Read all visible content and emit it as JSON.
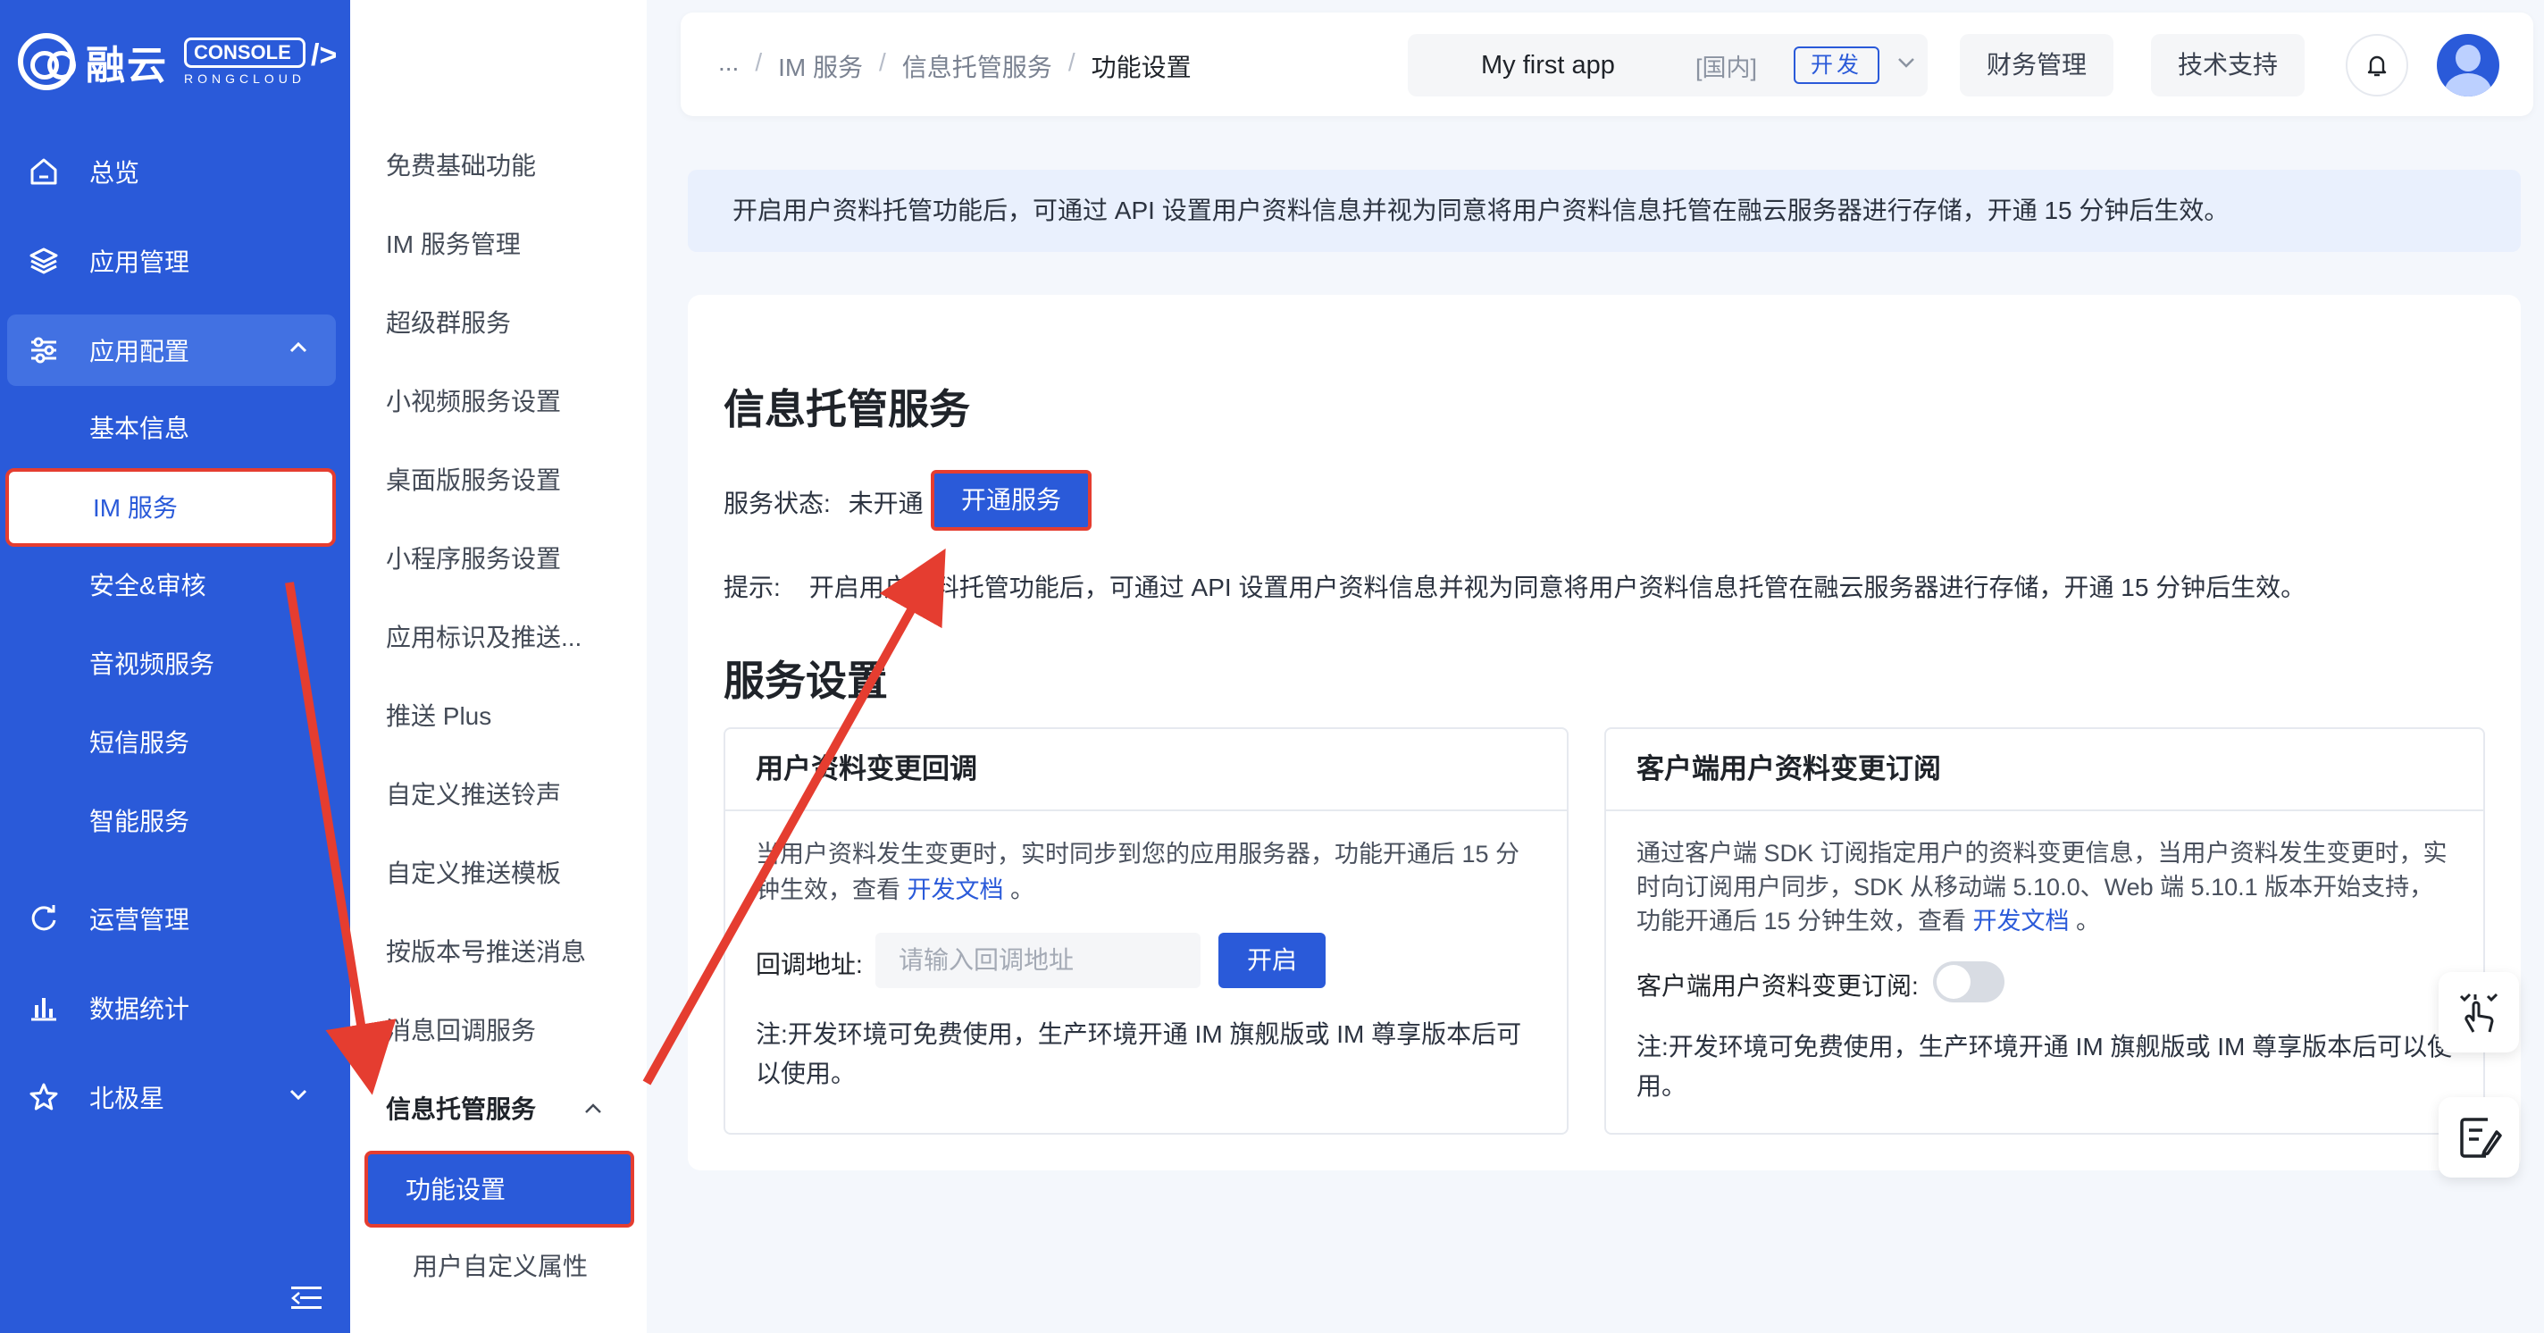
{
  "brand": {
    "name": "融云",
    "console": "CONSOLE",
    "sub": "RONGCLOUD"
  },
  "nav": {
    "items": [
      {
        "label": "总览",
        "icon": "home-icon"
      },
      {
        "label": "应用管理",
        "icon": "layers-icon"
      },
      {
        "label": "应用配置",
        "icon": "sliders-icon"
      },
      {
        "label": "运营管理",
        "icon": "refresh-icon"
      },
      {
        "label": "数据统计",
        "icon": "bar-chart-icon"
      },
      {
        "label": "北极星",
        "icon": "star-icon"
      }
    ],
    "config_children": [
      "基本信息",
      "IM 服务",
      "安全&审核",
      "音视频服务",
      "短信服务",
      "智能服务"
    ]
  },
  "submenu": {
    "items": [
      "免费基础功能",
      "IM 服务管理",
      "超级群服务",
      "小视频服务设置",
      "桌面版服务设置",
      "小程序服务设置",
      "应用标识及推送...",
      "推送 Plus",
      "自定义推送铃声",
      "自定义推送模板",
      "按版本号推送消息",
      "消息回调服务"
    ],
    "group": "信息托管服务",
    "group_children": [
      "功能设置",
      "用户自定义属性"
    ]
  },
  "header": {
    "breadcrumb": [
      "...",
      "IM 服务",
      "信息托管服务",
      "功能设置"
    ],
    "app_name": "My first app",
    "app_region": "[国内]",
    "app_env": "开发",
    "finance": "财务管理",
    "support": "技术支持"
  },
  "notice": "开启用户资料托管功能后，可通过 API 设置用户资料信息并视为同意将用户资料信息托管在融云服务器进行存储，开通 15 分钟后生效。",
  "main": {
    "title": "信息托管服务",
    "status_label": "服务状态:",
    "status_value": "未开通",
    "open_button": "开通服务",
    "tip_label": "提示:",
    "tip_text": "开启用户资料托管功能后，可通过 API 设置用户资料信息并视为同意将用户资料信息托管在融云服务器进行存储，开通 15 分钟后生效。",
    "settings_title": "服务设置",
    "callback": {
      "title": "用户资料变更回调",
      "desc": "当用户资料发生变更时，实时同步到您的应用服务器，功能开通后 15 分钟生效，查看 ",
      "link": "开发文档",
      "desc_end": " 。",
      "field_label": "回调地址:",
      "field_placeholder": "请输入回调地址",
      "field_button": "开启",
      "note": "注:开发环境可免费使用，生产环境开通 IM 旗舰版或 IM 尊享版本后可以使用。"
    },
    "subscribe": {
      "title": "客户端用户资料变更订阅",
      "desc": "通过客户端 SDK 订阅指定用户的资料变更信息，当用户资料发生变更时，实时向订阅用户同步，SDK 从移动端 5.10.0、Web 端 5.10.1 版本开始支持， 功能开通后 15 分钟生效，查看 ",
      "link": "开发文档",
      "desc_end": " 。",
      "toggle_label": "客户端用户资料变更订阅:",
      "toggle_on": false,
      "note": "注:开发环境可免费使用，生产环境开通 IM 旗舰版或 IM 尊享版本后可以使用。"
    }
  },
  "colors": {
    "primary": "#2a5ad9",
    "highlight": "#e53d30",
    "page_bg": "#f4f7fc"
  }
}
